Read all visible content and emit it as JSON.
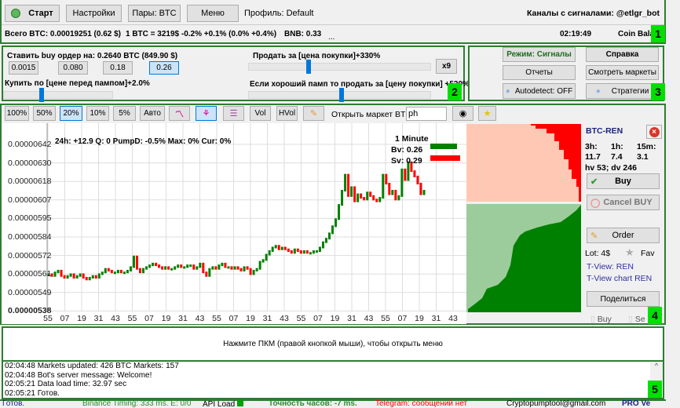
{
  "toolbar": {
    "start": "Старт",
    "settings": "Настройки",
    "pairs": "Пары: BTC",
    "menu": "Меню",
    "profile": "Профиль: Default",
    "channels": "Каналы с сигналами:  @etlgr_bot"
  },
  "info": {
    "total": "Всего BTC: 0.00019251 (0.62 $)",
    "rate": "1 BTC = 3219$  -0.2% +0.1% (0.0% +0.4%)",
    "bnb": "BNB: 0.33",
    "dots": "...",
    "time": "02:19:49",
    "coin": "Coin Bala"
  },
  "badges": [
    "1",
    "2",
    "3",
    "4",
    "5"
  ],
  "order": {
    "buy_label": "Ставить buy ордер на: 0.2640 BTC  (849.90 $)",
    "amounts": [
      "0.0015",
      "0.080",
      "0.18",
      "0.26"
    ],
    "selected_amount": "0.26",
    "buy_at": "Купить по [цене перед пампом]+2.0%",
    "sell_at": "Продать за [цена покупки]+330%",
    "x9": "x9",
    "good_pump": "Если хороший памп  то продать за [цену покупки] +520%",
    "buy_slider_pct": 35,
    "sell_slider_pct": 33,
    "pump_slider_pct": 51
  },
  "mode": {
    "mode": "Режим: Сигналы",
    "help": "Справка",
    "reports": "Отчеты",
    "markets": "Смотреть маркеты",
    "autodetect": "Autodetect: OFF",
    "strategies": "Стратегии"
  },
  "charttb": {
    "zooms": [
      "100%",
      "50%",
      "20%",
      "10%",
      "5%",
      "Авто"
    ],
    "selected_zoom": "20%",
    "vol": "Vol",
    "hvol": "HVol",
    "open_market": "Открыть маркет BTC-",
    "market_input": "ph"
  },
  "chart_data": {
    "type": "candlestick",
    "info": "24h: +12.9  Q: 0  PumpD: -0.5%  Max: 0%  Cur: 0%",
    "interval": "1 Minute",
    "bv": "Bv: 0.26",
    "sv": "Sv: 0.29",
    "yticks": [
      "0.00000642",
      "0.00000630",
      "0.00000618",
      "0.00000607",
      "0.00000595",
      "0.00000584",
      "0.00000572",
      "0.00000561",
      "0.00000549",
      "0.00000538"
    ],
    "xticks": [
      "55",
      "07",
      "19",
      "31",
      "43",
      "55",
      "07",
      "19",
      "31",
      "43",
      "55",
      "07",
      "19",
      "31",
      "43",
      "55",
      "07",
      "19",
      "31",
      "43",
      "55",
      "07",
      "19",
      "31",
      "43"
    ],
    "ylim": [
      538,
      644
    ],
    "closes": [
      559,
      558,
      560,
      561,
      558,
      557,
      558,
      559,
      557,
      558,
      559,
      557,
      556,
      557,
      558,
      557,
      559,
      560,
      562,
      561,
      560,
      560,
      561,
      560,
      560,
      561,
      563,
      569,
      562,
      560,
      562,
      563,
      564,
      565,
      564,
      563,
      562,
      563,
      562,
      562,
      563,
      564,
      563,
      563,
      564,
      564,
      562,
      563,
      565,
      560,
      558,
      562,
      563,
      562,
      564,
      565,
      563,
      563,
      562,
      563,
      562,
      561,
      563,
      562,
      559,
      561,
      562,
      566,
      567,
      570,
      572,
      574,
      575,
      573,
      574,
      573,
      572,
      571,
      573,
      572,
      571,
      572,
      571,
      571,
      572,
      572,
      574,
      577,
      579,
      582,
      586,
      590,
      598,
      606,
      615,
      603,
      608,
      600,
      604,
      602,
      601,
      605,
      603,
      601,
      600,
      602,
      615,
      610,
      604,
      606,
      601,
      603,
      618,
      612,
      622,
      617,
      614,
      610,
      604,
      606
    ]
  },
  "coin": {
    "pair": "BTC-REN",
    "h3": "3h:",
    "h1": "1h:",
    "m15": "15m:",
    "v3": "11.7",
    "v1": "7.4",
    "v15": "3.1",
    "hvdv": "hv 53; dv 246",
    "buy": "Buy",
    "cancel": "Cancel BUY",
    "order": "Order",
    "lot": "Lot: 4$",
    "fav": "Fav",
    "tview": "T-View: REN",
    "tview_chart": "T-View chart REN",
    "share": "Поделиться",
    "buy2": "Buy",
    "sell2": "Se"
  },
  "hint": "Нажмите ПКМ (правой кнопкой мыши), чтобы открыть меню",
  "log": [
    "02:04:48  Markets updated: 426  BTC Markets: 157",
    "02:04:48  Bot's server message: Welcome!",
    "02:05:21  Data load time: 32.97 sec",
    "02:05:21  Готов."
  ],
  "status": {
    "ready": "Готов.",
    "timing": "Binance Timing: 333 ms.   E: 0/0",
    "api": "API Load",
    "clock": "Точность часов: -7 ms.",
    "telegram": "Telegram: сообщений нет",
    "email": "Cryptopumptool@gmail.com",
    "pro": "PRO Ve"
  },
  "colors": {
    "up": "#008000",
    "down": "#ff0000",
    "panel": "#2e7d32",
    "badge": "#00e000"
  }
}
